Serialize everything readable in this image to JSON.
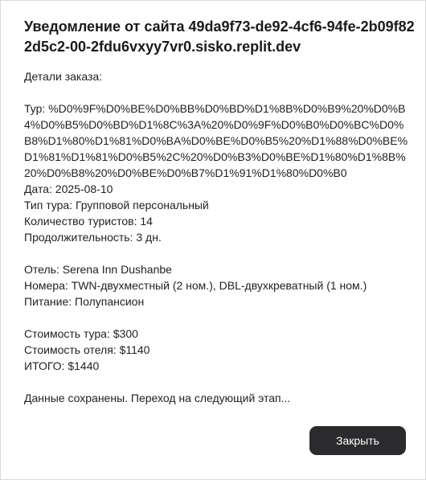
{
  "dialog": {
    "title": "Уведомление от сайта 49da9f73-de92-4cf6-94fe-2b09f822d5c2-00-2fdu6vxyy7vr0.sisko.replit.dev",
    "message_lines": [
      "Детали заказа:",
      "",
      "Тур: %D0%9F%D0%BE%D0%BB%D0%BD%D1%8B%D0%B9%20%D0%B4%D0%B5%D0%BD%D1%8C%3A%20%D0%9F%D0%B0%D0%BC%D0%B8%D1%80%D1%81%D0%BA%D0%BE%D0%B5%20%D1%88%D0%BE%D1%81%D1%81%D0%B5%2C%20%D0%B3%D0%BE%D1%80%D1%8B%20%D0%B8%20%D0%BE%D0%B7%D1%91%D1%80%D0%B0",
      "Дата: 2025-08-10",
      "Тип тура: Групповой персональный",
      "Количество туристов: 14",
      "Продолжительность: 3 дн.",
      "",
      "Отель: Serena Inn Dushanbe",
      "Номера: TWN-двухместный (2 ном.), DBL-двухкреватный (1 ном.)",
      "Питание: Полупансион",
      "",
      "Стоимость тура: $300",
      "Стоимость отеля: $1140",
      "ИТОГО: $1440",
      "",
      "Данные сохранены. Переход на следующий этап..."
    ],
    "close_label": "Закрыть"
  }
}
